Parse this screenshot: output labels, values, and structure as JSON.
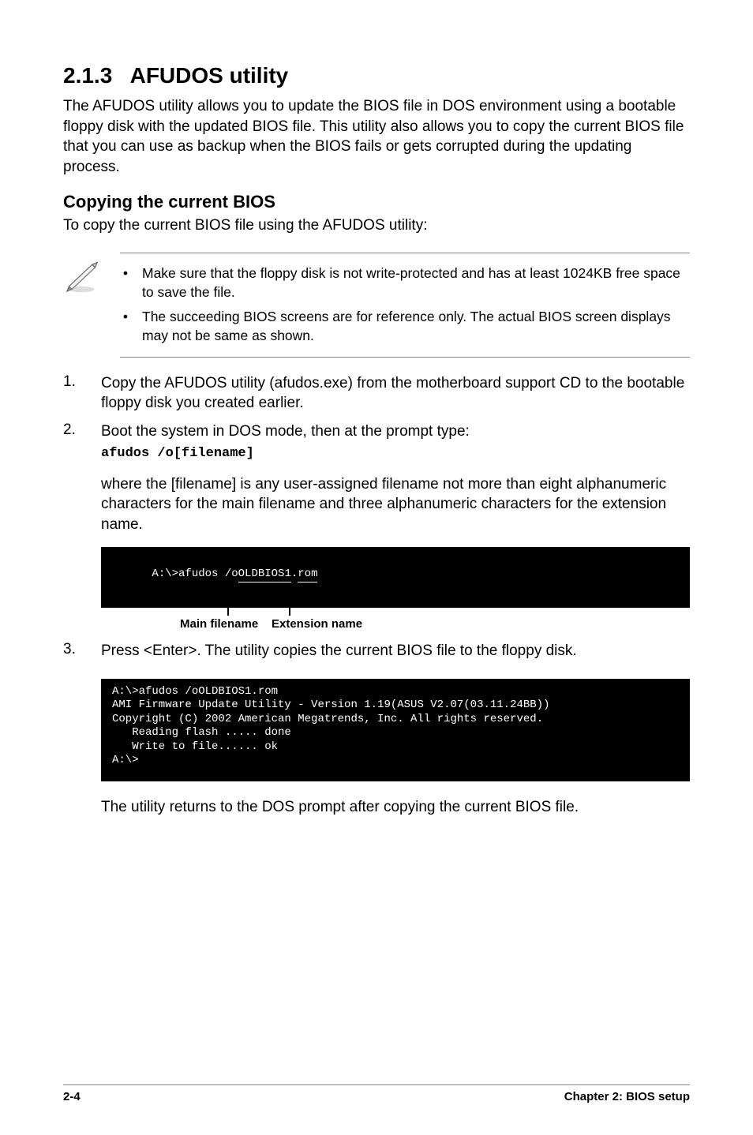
{
  "section": {
    "number": "2.1.3",
    "title": "AFUDOS utility"
  },
  "intro": "The AFUDOS utility allows you to update the BIOS file in DOS environment using a bootable floppy disk with the updated BIOS file. This utility also allows you to copy the current BIOS file that you can use as backup when the BIOS fails or gets corrupted during the updating process.",
  "subhead": "Copying the current BIOS",
  "subhead_intro": "To copy the current BIOS file using the AFUDOS utility:",
  "notes": [
    "Make sure that the floppy disk is not write-protected and has at least 1024KB free space to save the file.",
    "The succeeding BIOS screens are for reference only. The actual BIOS screen displays may not be same as shown."
  ],
  "steps": [
    {
      "num": "1.",
      "text": "Copy the AFUDOS utility (afudos.exe) from the motherboard support CD to the bootable floppy disk you created earlier."
    },
    {
      "num": "2.",
      "text": "Boot the system in DOS mode, then at the prompt type:",
      "cmd": "afudos /o[filename]"
    }
  ],
  "step2_desc": "where the [filename] is any user-assigned filename not more than eight alphanumeric characters  for the main filename and three alphanumeric characters for the extension name.",
  "terminal1": {
    "prefix": "A:\\>afudos /o",
    "main": "OLDBIOS1",
    "dot": ".",
    "ext": "rom"
  },
  "annotations": {
    "main": "Main filename",
    "ext": "Extension name"
  },
  "step3": {
    "num": "3.",
    "text": "Press <Enter>. The utility copies the current BIOS file to the floppy disk."
  },
  "terminal2": [
    "A:\\>afudos /oOLDBIOS1.rom",
    "AMI Firmware Update Utility - Version 1.19(ASUS V2.07(03.11.24BB))",
    "Copyright (C) 2002 American Megatrends, Inc. All rights reserved.",
    "   Reading flash ..... done",
    "   Write to file...... ok",
    "A:\\>"
  ],
  "closing": "The utility returns to the DOS prompt after copying the current BIOS file.",
  "footer": {
    "left": "2-4",
    "right": "Chapter 2: BIOS setup"
  }
}
